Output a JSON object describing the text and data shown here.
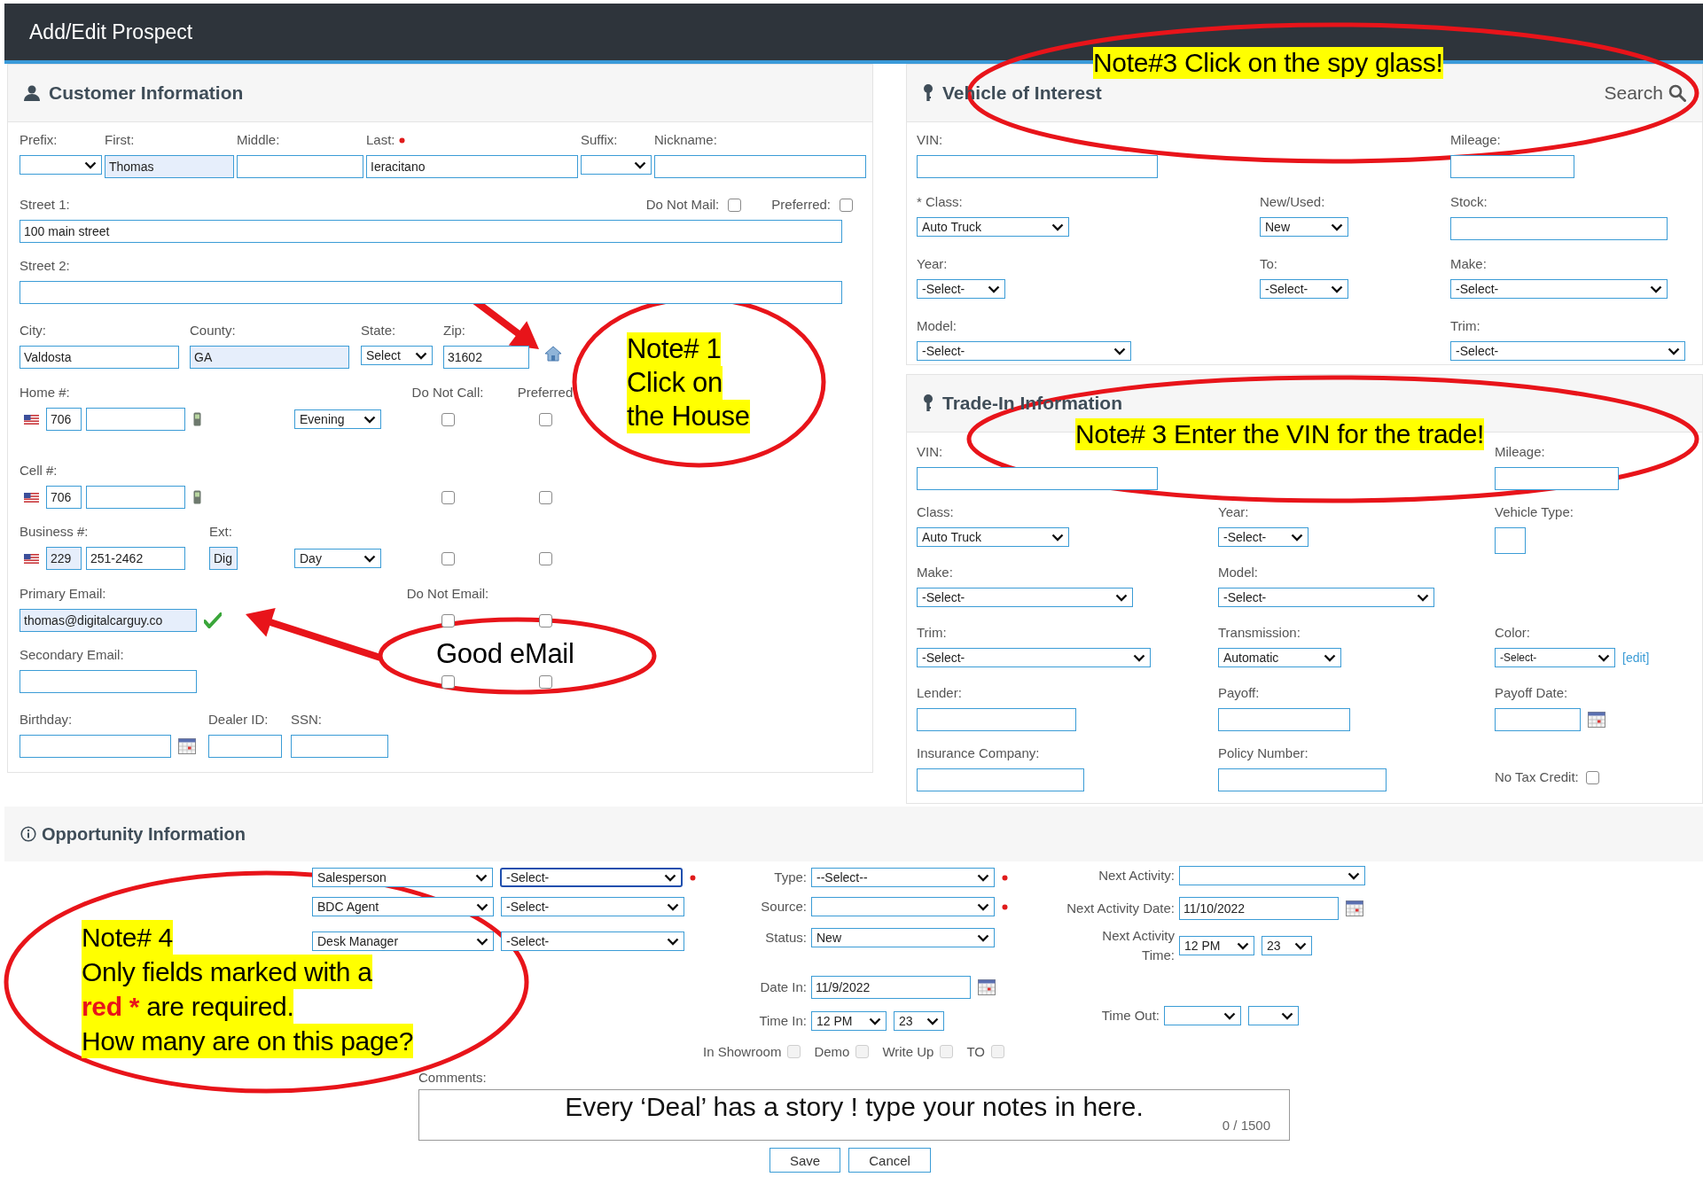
{
  "title": "Add/Edit Prospect",
  "customer": {
    "title": "Customer Information",
    "name_row": [
      {
        "label": "Prefix:",
        "kind": "select",
        "required": false
      },
      {
        "label": "First:",
        "kind": "input",
        "value": "Thomas",
        "filled": true,
        "required": false
      },
      {
        "label": "Middle:",
        "kind": "input",
        "filled": false,
        "required": false
      },
      {
        "label": "Last:",
        "kind": "input",
        "value": "Ieracitano",
        "filled": false,
        "required": true
      },
      {
        "label": "Suffix:",
        "kind": "select",
        "required": false
      },
      {
        "label": "Nickname:",
        "kind": "input",
        "filled": false,
        "required": false
      }
    ],
    "streets": [
      {
        "label": "Street 1:",
        "value": "100 main street",
        "options": [
          {
            "label": "Do Not Mail:",
            "checked": false
          },
          {
            "label": "Preferred:",
            "checked": false
          }
        ]
      },
      {
        "label": "Street 2:"
      }
    ],
    "address_row": [
      {
        "label": "City:",
        "kind": "input",
        "value": "Valdosta",
        "filled": false
      },
      {
        "label": "County:",
        "kind": "input",
        "value": "GA",
        "filled": true
      },
      {
        "label": "State:",
        "kind": "select",
        "value": "Select"
      },
      {
        "label": "Zip:",
        "kind": "input",
        "value": "31602",
        "filled": false
      }
    ],
    "phone_headers": [
      "Do Not Call:",
      "Preferred"
    ],
    "phones": [
      {
        "label": "Home #:",
        "kind": "mobile",
        "area": {
          "value": "706",
          "filled": false
        },
        "number": {
          "filled": false
        },
        "time": "Evening",
        "do_not_call": false,
        "preferred": false
      },
      {
        "label": "Cell #:",
        "kind": "mobile",
        "area": {
          "value": "706",
          "filled": false
        },
        "number": {
          "filled": false
        },
        "do_not_call": false,
        "preferred": false
      },
      {
        "label": "Business #:",
        "kind": "business",
        "area": {
          "value": "229",
          "filled": true
        },
        "number": {
          "value": "251-2462",
          "filled": false
        },
        "ext": {
          "label": "Ext:",
          "value": "Dig",
          "filled": true
        },
        "time": "Day",
        "do_not_call": false,
        "preferred": false
      }
    ],
    "email_header": "Do Not Email:",
    "emails": [
      {
        "label": "Primary Email:",
        "value": "thomas@digitalcarguy.co",
        "filled": true,
        "valid": true,
        "do_not_email": false,
        "preferred": false
      },
      {
        "label": "Secondary Email:",
        "filled": false,
        "valid": false,
        "do_not_email": false,
        "preferred": false
      }
    ],
    "extra_row": [
      {
        "label": "Birthday:",
        "kind": "date"
      },
      {
        "label": "Dealer ID:",
        "kind": "input"
      },
      {
        "label": "SSN:",
        "kind": "input"
      }
    ]
  },
  "vehicle": {
    "title": "Vehicle of Interest",
    "search": "Search",
    "rows": [
      [
        {
          "label": "VIN:",
          "kind": "input"
        },
        {
          "kind": "blank"
        },
        {
          "label": "Mileage:",
          "kind": "input"
        }
      ],
      [
        {
          "label": "* Class:",
          "kind": "select",
          "value": "Auto Truck"
        },
        {
          "label": "New/Used:",
          "kind": "select",
          "value": "New"
        },
        {
          "label": "Stock:",
          "kind": "input"
        }
      ],
      [
        {
          "label": "Year:",
          "kind": "select",
          "value": "-Select-"
        },
        {
          "label": "To:",
          "kind": "select",
          "value": "-Select-"
        },
        {
          "label": "Make:",
          "kind": "select",
          "value": "-Select-"
        }
      ],
      [
        {
          "label": "Model:",
          "kind": "select",
          "value": "-Select-"
        },
        {
          "kind": "blank"
        },
        {
          "label": "Trim:",
          "kind": "select",
          "value": "-Select-"
        }
      ]
    ]
  },
  "trade": {
    "title": "Trade-In Information",
    "rows": [
      [
        {
          "label": "VIN:",
          "kind": "input"
        },
        {
          "kind": "blank"
        },
        {
          "label": "Mileage:",
          "kind": "input"
        }
      ],
      [
        {
          "label": "Class:",
          "kind": "select",
          "value": "Auto Truck"
        },
        {
          "label": "Year:",
          "kind": "select",
          "value": "-Select-"
        },
        {
          "label": "Vehicle Type:",
          "kind": "input"
        }
      ],
      [
        {
          "label": "Make:",
          "kind": "select",
          "value": "-Select-"
        },
        {
          "label": "Model:",
          "kind": "select",
          "value": "-Select-"
        },
        {
          "kind": "blank"
        }
      ],
      [
        {
          "label": "Trim:",
          "kind": "select",
          "value": "-Select-"
        },
        {
          "label": "Transmission:",
          "kind": "select",
          "value": "Automatic"
        },
        {
          "label": "Color:",
          "kind": "select",
          "value": "-Select-",
          "link": "[edit]"
        }
      ],
      [
        {
          "label": "Lender:",
          "kind": "input"
        },
        {
          "label": "Payoff:",
          "kind": "input"
        },
        {
          "label": "Payoff Date:",
          "kind": "date"
        }
      ],
      [
        {
          "label": "Insurance Company:",
          "kind": "input"
        },
        {
          "label": "Policy Number:",
          "kind": "input"
        },
        {
          "label": "No Tax Credit:",
          "kind": "checkbox",
          "checked": false
        }
      ]
    ]
  },
  "opportunity": {
    "title": "Opportunity Information",
    "staff": [
      {
        "role": "Salesperson",
        "person": "-Select-",
        "focused": true,
        "required": true
      },
      {
        "role": "BDC Agent",
        "person": "-Select-",
        "focused": false,
        "required": false
      },
      {
        "role": "Desk Manager",
        "person": "-Select-",
        "focused": false,
        "required": false
      }
    ],
    "details": [
      {
        "label": "Type:",
        "kind": "select",
        "value": "--Select--",
        "required": true
      },
      {
        "label": "Source:",
        "kind": "select",
        "required": true
      },
      {
        "label": "Status:",
        "kind": "select",
        "value": "New",
        "required": false
      },
      {
        "label": "Date In:",
        "kind": "date",
        "value": "11/9/2022",
        "required": false
      },
      {
        "label": "Time In:",
        "kind": "time",
        "hour": "12 PM",
        "minute": "23",
        "required": false
      }
    ],
    "flags": [
      {
        "label": "In Showroom",
        "checked": false,
        "disabled": true
      },
      {
        "label": "Demo",
        "checked": false,
        "disabled": true
      },
      {
        "label": "Write Up",
        "checked": false,
        "disabled": true
      },
      {
        "label": "TO",
        "checked": false,
        "disabled": true
      }
    ],
    "activity": [
      {
        "label": "Next Activity:",
        "kind": "select"
      },
      {
        "label": "Next Activity Date:",
        "kind": "date",
        "value": "11/10/2022"
      },
      {
        "label": "Next Activity Time:",
        "kind": "time",
        "hour": "12 PM",
        "minute": "23"
      }
    ],
    "time_out": {
      "label": "Time Out:"
    },
    "comments": {
      "label": "Comments:",
      "value": "Every ‘Deal’ has a story ! type your notes in here.",
      "counter": "0 / 1500"
    },
    "buttons": [
      "Save",
      "Cancel"
    ]
  },
  "annotations": [
    {
      "kind": "callout",
      "highlighted": true,
      "lines": [
        [
          {
            "text": "Note#3 Click on the spy glass!",
            "strong": false
          }
        ]
      ]
    },
    {
      "kind": "callout",
      "highlighted": true,
      "lines": [
        [
          {
            "text": "Note# 3 Enter the VIN for the trade!",
            "strong": false
          }
        ]
      ]
    },
    {
      "kind": "callout",
      "highlighted": true,
      "lines": [
        [
          {
            "text": "Note# 1",
            "strong": false
          }
        ],
        [
          {
            "text": "Click on",
            "strong": false
          }
        ],
        [
          {
            "text": "the House",
            "strong": false
          }
        ]
      ]
    },
    {
      "kind": "arrow"
    },
    {
      "kind": "callout",
      "highlighted": false,
      "lines": [
        [
          {
            "text": "Good eMail",
            "strong": false
          }
        ]
      ]
    },
    {
      "kind": "arrow"
    },
    {
      "kind": "callout",
      "highlighted": true,
      "lines": [
        [
          {
            "text": "Note# 4",
            "strong": false
          }
        ],
        [
          {
            "text": "Only fields marked with a",
            "strong": false
          }
        ],
        [
          {
            "text": "red *",
            "strong": true
          },
          {
            "text": " are required.",
            "strong": false
          }
        ],
        [
          {
            "text": "How many are on this page?",
            "strong": false
          }
        ]
      ]
    }
  ]
}
